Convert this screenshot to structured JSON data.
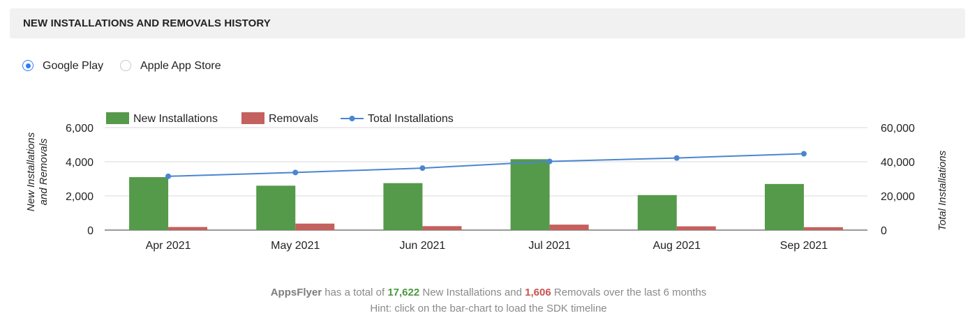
{
  "header": {
    "title": "NEW INSTALLATIONS AND REMOVALS HISTORY"
  },
  "store_options": [
    {
      "label": "Google Play",
      "selected": true
    },
    {
      "label": "Apple App Store",
      "selected": false
    }
  ],
  "chart_data": {
    "type": "bar",
    "categories": [
      "Apr 2021",
      "May 2021",
      "Jun 2021",
      "Jul 2021",
      "Aug 2021",
      "Sep 2021"
    ],
    "series": [
      {
        "name": "New Installations",
        "type": "bar",
        "axis": "left",
        "color": "#559a4a",
        "values": [
          3100,
          2600,
          2750,
          4150,
          2050,
          2700
        ]
      },
      {
        "name": "Removals",
        "type": "bar",
        "axis": "left",
        "color": "#c4605e",
        "values": [
          180,
          380,
          230,
          320,
          220,
          170
        ]
      },
      {
        "name": "Total Installations",
        "type": "line",
        "axis": "right",
        "color": "#4a86d0",
        "values": [
          31500,
          33700,
          36300,
          40200,
          42200,
          44700
        ]
      }
    ],
    "ylabel": "New Installations and Removals",
    "ylabel_lines": [
      "New Installations",
      "and Removals"
    ],
    "y2label": "Total Installations",
    "ylim": [
      0,
      6000
    ],
    "y2lim": [
      0,
      60000
    ],
    "yticks": [
      "0",
      "2,000",
      "4,000",
      "6,000"
    ],
    "y2ticks": [
      "0",
      "20,000",
      "40,000",
      "60,000"
    ],
    "grid": true,
    "legend_position": "top-left"
  },
  "summary": {
    "app_name": "AppsFlyer",
    "text_1": "has a total of",
    "installs": "17,622",
    "text_2": "New Installations and",
    "removals": "1,606",
    "text_3": "Removals over the last 6 months",
    "hint": "Hint: click on the bar-chart to load the SDK timeline"
  }
}
